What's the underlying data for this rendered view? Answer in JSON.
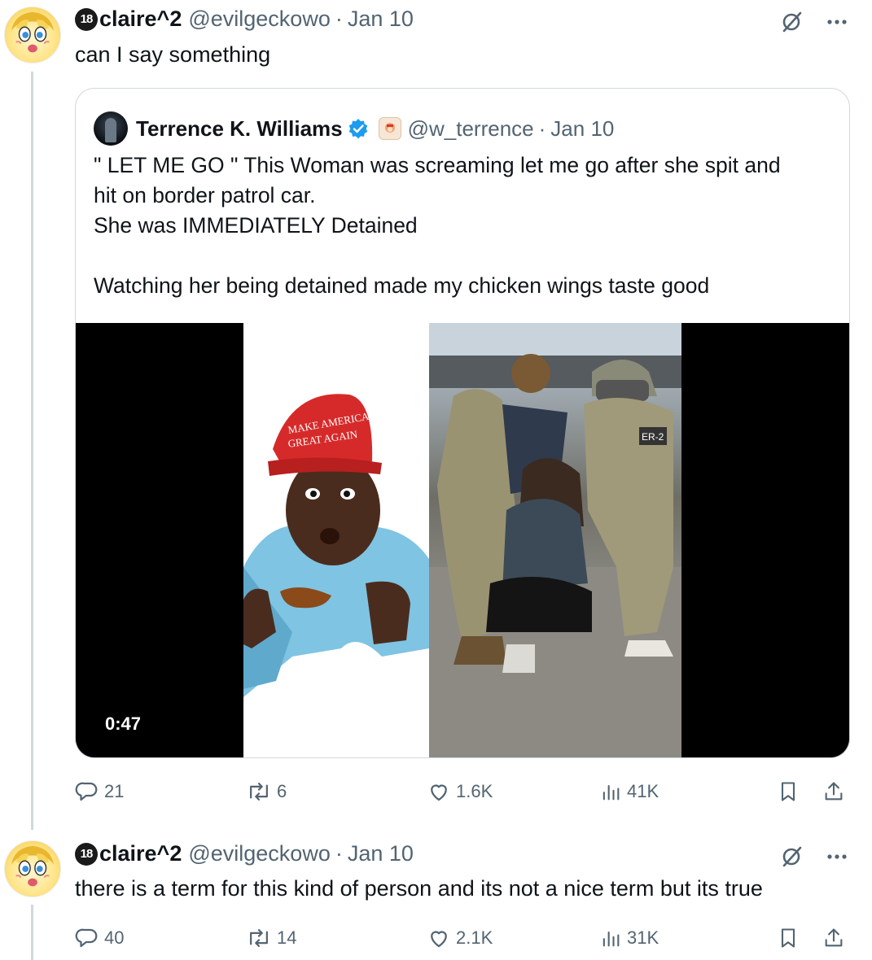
{
  "thread": {
    "first_reply": {
      "author_badge": "18",
      "author_name": "claire^2",
      "handle": "@evilgeckowo",
      "separator": "·",
      "date": "Jan 10",
      "text": "can I say something"
    },
    "quoted_tweet": {
      "author_name": "Terrence K. Williams",
      "handle": "@w_terrence",
      "separator": "·",
      "date": "Jan 10",
      "lines": [
        "\" LET ME GO \" This Woman was screaming let me go after she spit and",
        "hit on border patrol car.",
        "She was IMMEDIATELY Detained",
        "",
        "Watching her being detained made my chicken wings taste good"
      ],
      "video_duration": "0:47",
      "hat_text_line1": "MAKE AMERICA",
      "hat_text_line2": "GREAT AGAIN",
      "vest_patch": "ER-2"
    },
    "first_actions": {
      "replies": "21",
      "reposts": "6",
      "likes": "1.6K",
      "views": "41K"
    },
    "second_reply": {
      "author_badge": "18",
      "author_name": "claire^2",
      "handle": "@evilgeckowo",
      "separator": "·",
      "date": "Jan 10",
      "text": "there is a term for this kind of person and its not a nice term but its true"
    },
    "second_actions": {
      "replies": "40",
      "reposts": "14",
      "likes": "2.1K",
      "views": "31K"
    }
  },
  "icons": {
    "reply": "reply-icon",
    "repost": "repost-icon",
    "like": "heart-icon",
    "views": "views-icon",
    "bookmark": "bookmark-icon",
    "share": "share-icon",
    "grok": "grok-icon",
    "more": "more-icon",
    "verified": "verified-badge-icon"
  },
  "colors": {
    "verified": "#1d9bf0",
    "muted": "#536471",
    "thread_line": "#cfd9de",
    "hat_red": "#d62a2a"
  }
}
